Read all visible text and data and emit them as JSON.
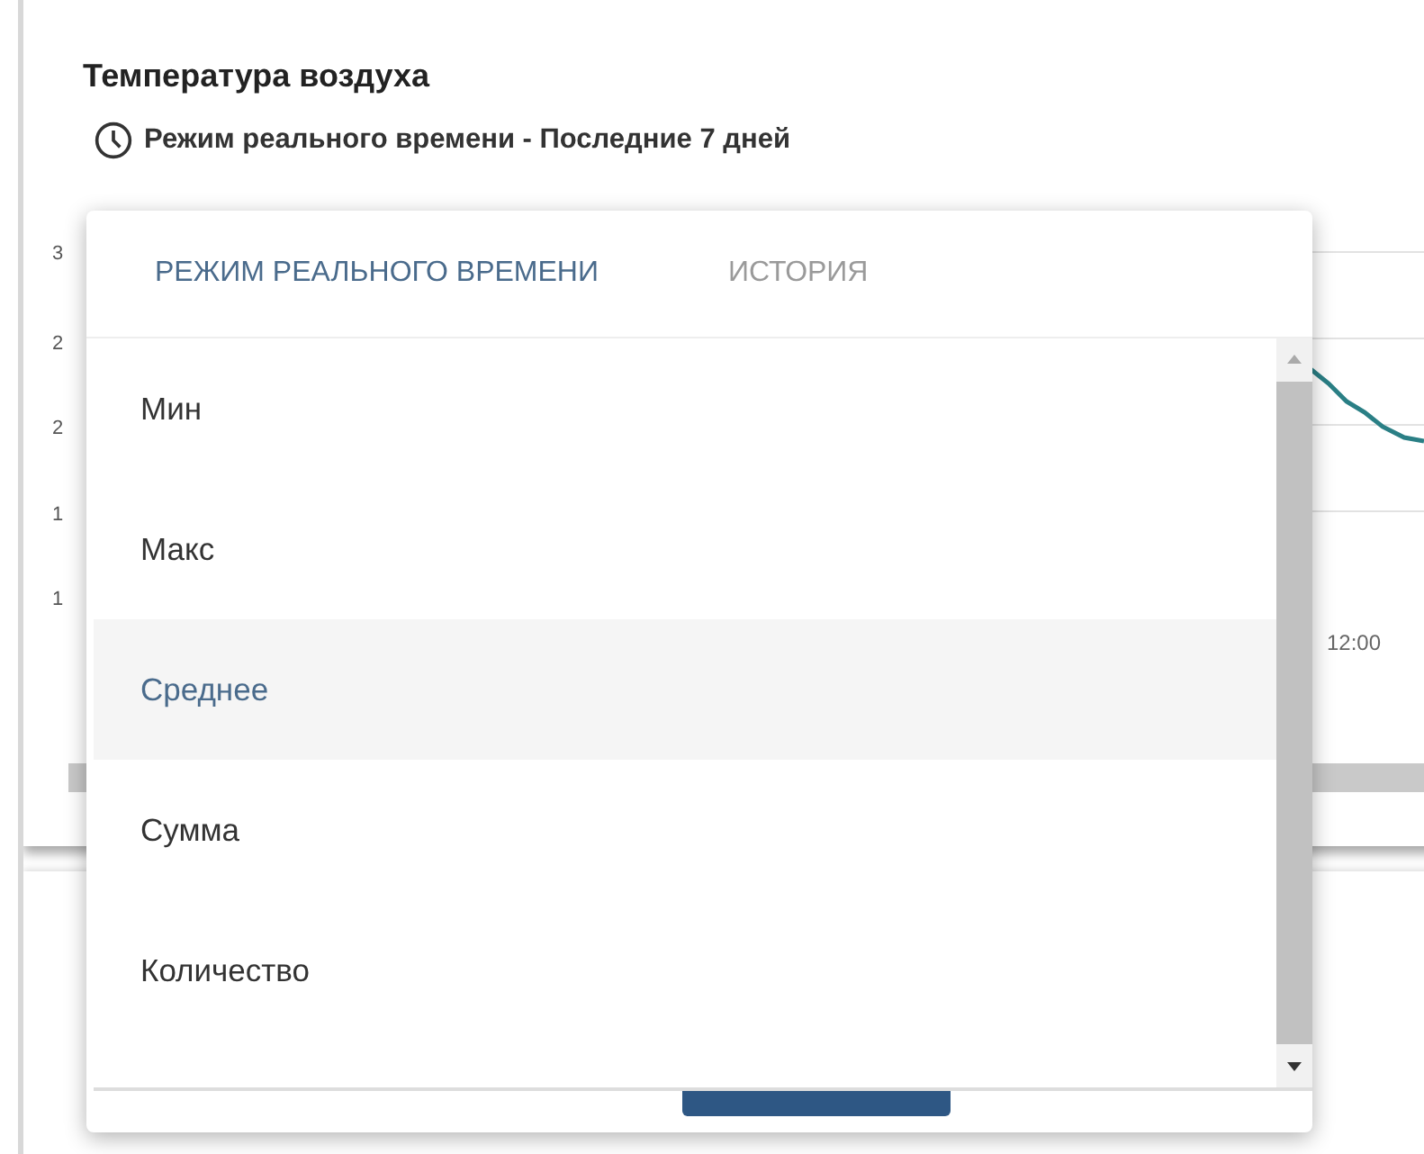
{
  "card": {
    "title": "Температура воздуха",
    "subtitle": "Режим реального времени - Последние 7 дней"
  },
  "chart_background": {
    "y_ticks": [
      "3",
      "2",
      "2",
      "1",
      "1"
    ],
    "x_tick": "12:00"
  },
  "dropdown": {
    "tabs": [
      {
        "label": "РЕЖИМ РЕАЛЬНОГО ВРЕМЕНИ",
        "selected": true
      },
      {
        "label": "ИСТОРИЯ",
        "selected": false
      }
    ],
    "items": [
      {
        "label": "Мин",
        "selected": false
      },
      {
        "label": "Макс",
        "selected": false
      },
      {
        "label": "Среднее",
        "selected": true
      },
      {
        "label": "Сумма",
        "selected": false
      },
      {
        "label": "Количество",
        "selected": false
      }
    ]
  }
}
